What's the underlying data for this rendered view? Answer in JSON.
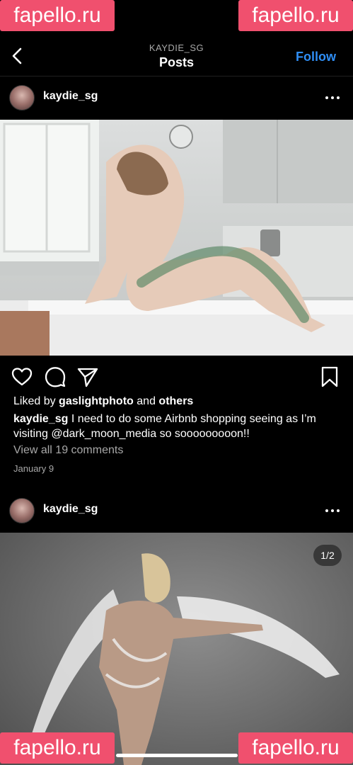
{
  "watermark": "fapello.ru",
  "header": {
    "subtitle": "KAYDIE_SG",
    "title": "Posts",
    "follow_label": "Follow"
  },
  "posts": [
    {
      "username": "kaydie_sg",
      "liked_prefix": "Liked by",
      "liked_user": "gaslightphoto",
      "liked_and": "and",
      "liked_others": "others",
      "caption_user": "kaydie_sg",
      "caption_text": "I need to do some Airbnb shopping seeing as I’m visiting @dark_moon_media so sooooooooon!!",
      "comments_label": "View all 19 comments",
      "date": "January 9"
    },
    {
      "username": "kaydie_sg",
      "page_indicator": "1/2"
    }
  ],
  "icons": [
    "back-icon",
    "more-icon",
    "heart-icon",
    "comment-icon",
    "share-icon",
    "bookmark-icon"
  ],
  "colors": {
    "background": "#000000",
    "follow": "#2f8ef5",
    "muted": "#a8a8a8",
    "watermark": "#f0506e"
  }
}
